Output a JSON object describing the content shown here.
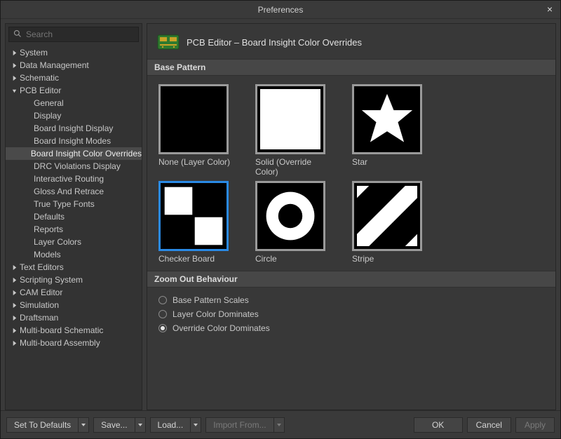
{
  "window": {
    "title": "Preferences"
  },
  "search": {
    "placeholder": "Search"
  },
  "tree": [
    {
      "label": "System",
      "level": 0,
      "expanded": false,
      "hasChildren": true
    },
    {
      "label": "Data Management",
      "level": 0,
      "expanded": false,
      "hasChildren": true
    },
    {
      "label": "Schematic",
      "level": 0,
      "expanded": false,
      "hasChildren": true
    },
    {
      "label": "PCB Editor",
      "level": 0,
      "expanded": true,
      "hasChildren": true
    },
    {
      "label": "General",
      "level": 1
    },
    {
      "label": "Display",
      "level": 1
    },
    {
      "label": "Board Insight Display",
      "level": 1
    },
    {
      "label": "Board Insight Modes",
      "level": 1
    },
    {
      "label": "Board Insight Color Overrides",
      "level": 1,
      "selected": true
    },
    {
      "label": "DRC Violations Display",
      "level": 1
    },
    {
      "label": "Interactive Routing",
      "level": 1
    },
    {
      "label": "Gloss And Retrace",
      "level": 1
    },
    {
      "label": "True Type Fonts",
      "level": 1
    },
    {
      "label": "Defaults",
      "level": 1
    },
    {
      "label": "Reports",
      "level": 1
    },
    {
      "label": "Layer Colors",
      "level": 1
    },
    {
      "label": "Models",
      "level": 1
    },
    {
      "label": "Text Editors",
      "level": 0,
      "expanded": false,
      "hasChildren": true
    },
    {
      "label": "Scripting System",
      "level": 0,
      "expanded": false,
      "hasChildren": true
    },
    {
      "label": "CAM Editor",
      "level": 0,
      "expanded": false,
      "hasChildren": true
    },
    {
      "label": "Simulation",
      "level": 0,
      "expanded": false,
      "hasChildren": true
    },
    {
      "label": "Draftsman",
      "level": 0,
      "expanded": false,
      "hasChildren": true
    },
    {
      "label": "Multi-board Schematic",
      "level": 0,
      "expanded": false,
      "hasChildren": true
    },
    {
      "label": "Multi-board Assembly",
      "level": 0,
      "expanded": false,
      "hasChildren": true
    }
  ],
  "page": {
    "title": "PCB Editor – Board Insight Color Overrides",
    "sections": {
      "basePattern": "Base Pattern",
      "zoomOut": "Zoom Out Behaviour"
    }
  },
  "patterns": [
    {
      "key": "none",
      "label": "None (Layer Color)",
      "selected": false
    },
    {
      "key": "solid",
      "label": "Solid (Override Color)",
      "selected": false
    },
    {
      "key": "star",
      "label": "Star",
      "selected": false
    },
    {
      "key": "checker",
      "label": "Checker Board",
      "selected": true
    },
    {
      "key": "circle",
      "label": "Circle",
      "selected": false
    },
    {
      "key": "stripe",
      "label": "Stripe",
      "selected": false
    }
  ],
  "zoomOut": {
    "options": [
      {
        "label": "Base Pattern Scales",
        "checked": false
      },
      {
        "label": "Layer Color Dominates",
        "checked": false
      },
      {
        "label": "Override Color Dominates",
        "checked": true
      }
    ]
  },
  "footer": {
    "setDefaults": "Set To Defaults",
    "save": "Save...",
    "load": "Load...",
    "importFrom": "Import From...",
    "ok": "OK",
    "cancel": "Cancel",
    "apply": "Apply"
  }
}
